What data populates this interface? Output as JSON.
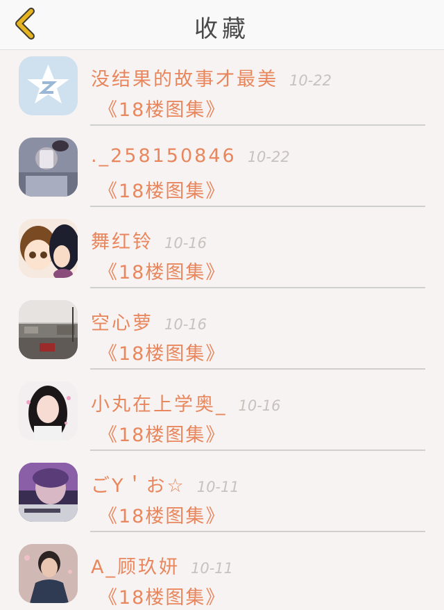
{
  "header": {
    "title": "收藏",
    "back_icon": "chevron-left-icon"
  },
  "items": [
    {
      "name": "没结果的故事才最美",
      "date": "10-22",
      "topic": "《18楼图集》",
      "avatar_icon": "star-app-icon"
    },
    {
      "name": "._258150846",
      "date": "10-22",
      "topic": "《18楼图集》",
      "avatar_icon": "avatar-photo"
    },
    {
      "name": "舞红铃",
      "date": "10-16",
      "topic": "《18楼图集》",
      "avatar_icon": "avatar-photo"
    },
    {
      "name": "空心萝",
      "date": "10-16",
      "topic": "《18楼图集》",
      "avatar_icon": "avatar-photo"
    },
    {
      "name": "小丸在上学奥_",
      "date": "10-16",
      "topic": "《18楼图集》",
      "avatar_icon": "avatar-photo"
    },
    {
      "name": "ごY＇お☆",
      "date": "10-11",
      "topic": "《18楼图集》",
      "avatar_icon": "avatar-photo"
    },
    {
      "name": "A_顾玖妍",
      "date": "10-11",
      "topic": "《18楼图集》",
      "avatar_icon": "avatar-photo"
    }
  ],
  "colors": {
    "accent": "#e8875e",
    "date": "#c8c1be",
    "back": "#e6b422"
  }
}
